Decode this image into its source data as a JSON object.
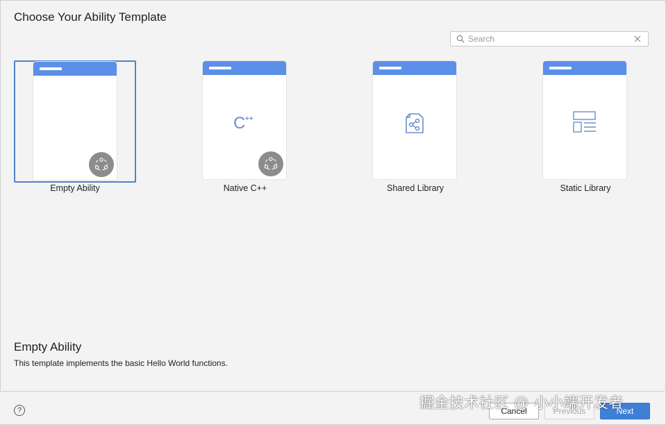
{
  "dialog": {
    "title": "Choose Your Ability Template"
  },
  "search": {
    "placeholder": "Search",
    "value": ""
  },
  "templates": [
    {
      "label": "Empty Ability",
      "icon": "empty-template",
      "badge": "ability-badge-icon",
      "selected": true
    },
    {
      "label": "Native C++",
      "icon": "cpp-icon",
      "glyph_text": "C",
      "glyph_sup": "++",
      "badge": "ability-badge-icon",
      "selected": false
    },
    {
      "label": "Shared Library",
      "icon": "share-icon",
      "selected": false
    },
    {
      "label": "Static Library",
      "icon": "layout-icon",
      "selected": false
    }
  ],
  "description": {
    "title": "Empty Ability",
    "text": "This template implements the basic Hello World functions."
  },
  "footer": {
    "help_label": "?",
    "cancel_label": "Cancel",
    "previous_label": "Previous",
    "next_label": "Next"
  },
  "watermark": {
    "text": "掘金技术社区 @ 小小端开发者"
  },
  "colors": {
    "accent": "#5b8fe8",
    "primary_button": "#3f7fd6",
    "selection_border": "#4a84c9",
    "badge": "#8c8c8c",
    "icon_blue": "#6a8fc9"
  }
}
